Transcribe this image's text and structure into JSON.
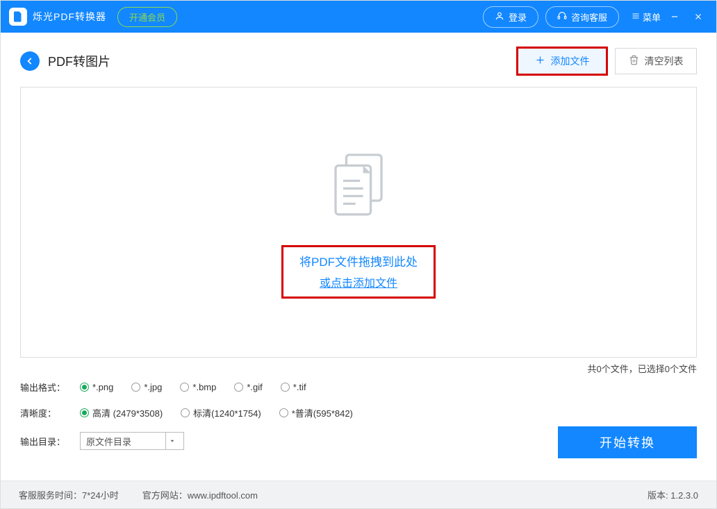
{
  "titlebar": {
    "app_name": "烁光PDF转换器",
    "membership_label": "开通会员",
    "login_label": "登录",
    "support_label": "咨询客服",
    "menu_label": "菜单"
  },
  "page": {
    "title": "PDF转图片",
    "add_file_label": "添加文件",
    "clear_list_label": "清空列表"
  },
  "dropzone": {
    "line1": "将PDF文件拖拽到此处",
    "line2": "或点击添加文件"
  },
  "status": {
    "text": "共0个文件，已选择0个文件"
  },
  "options": {
    "format_label": "输出格式：",
    "formats": [
      "*.png",
      "*.jpg",
      "*.bmp",
      "*.gif",
      "*.tif"
    ],
    "format_selected": 0,
    "quality_label": "清晰度：",
    "qualities": [
      "高清 (2479*3508)",
      "标清(1240*1754)",
      "*普清(595*842)"
    ],
    "quality_selected": 0,
    "outdir_label": "输出目录：",
    "outdir_value": "原文件目录",
    "convert_label": "开始转换"
  },
  "footer": {
    "service_label": "客服服务时间：7*24小时",
    "site_label": "官方网站：www.ipdftool.com",
    "version_label": "版本: 1.2.3.0"
  }
}
